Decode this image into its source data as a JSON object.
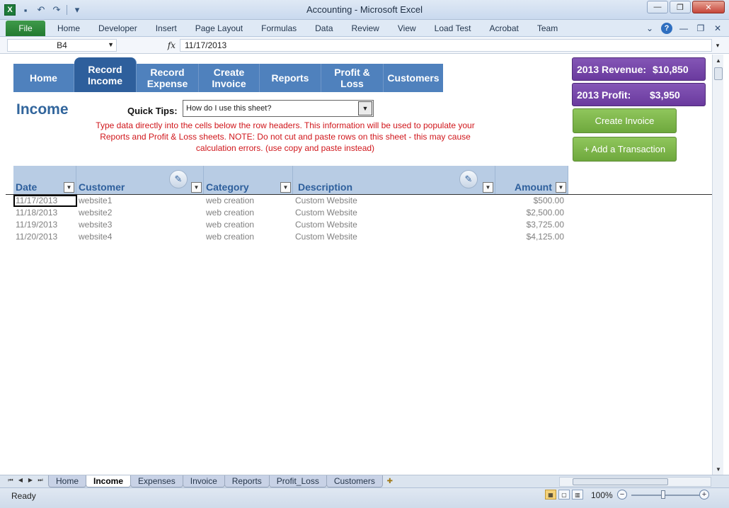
{
  "window": {
    "title": "Accounting  -  Microsoft Excel",
    "app_icon": "X"
  },
  "ribbon": {
    "file_tab": "File",
    "tabs": [
      "Home",
      "Developer",
      "Insert",
      "Page Layout",
      "Formulas",
      "Data",
      "Review",
      "View",
      "Load Test",
      "Acrobat",
      "Team"
    ]
  },
  "formula_bar": {
    "name_box": "B4",
    "fx_label": "fx",
    "value": "11/17/2013"
  },
  "nav": {
    "items": [
      {
        "label": "Home"
      },
      {
        "label": "Record Income",
        "active": true
      },
      {
        "label": "Record Expense"
      },
      {
        "label": "Create Invoice"
      },
      {
        "label": "Reports"
      },
      {
        "label": "Profit & Loss"
      },
      {
        "label": "Customers"
      }
    ]
  },
  "page": {
    "title": "Income",
    "quick_tips_label": "Quick Tips:",
    "quick_tips_selected": "How do I use this sheet?",
    "tips_text": "Type data directly into the cells below the row headers.  This information will be used to populate your Reports and Profit & Loss sheets.  NOTE: Do not cut and paste rows on this sheet - this may cause calculation errors. (use copy and paste instead)"
  },
  "summary": {
    "revenue_label": "2013 Revenue:",
    "revenue_value": "$10,850",
    "profit_label": "2013 Profit:",
    "profit_value": "$3,950"
  },
  "actions": {
    "create_invoice": "Create Invoice",
    "add_transaction": "+ Add a Transaction"
  },
  "table": {
    "headers": [
      "Date",
      "Customer",
      "Category",
      "Description",
      "Amount"
    ],
    "rows": [
      {
        "date": "11/17/2013",
        "customer": "website1",
        "category": "web creation",
        "description": "Custom Website",
        "amount": "$500.00"
      },
      {
        "date": "11/18/2013",
        "customer": "website2",
        "category": "web creation",
        "description": "Custom Website",
        "amount": "$2,500.00"
      },
      {
        "date": "11/19/2013",
        "customer": "website3",
        "category": "web creation",
        "description": "Custom Website",
        "amount": "$3,725.00"
      },
      {
        "date": "11/20/2013",
        "customer": "website4",
        "category": "web creation",
        "description": "Custom Website",
        "amount": "$4,125.00"
      }
    ]
  },
  "sheet_tabs": {
    "tabs": [
      "Home",
      "Income",
      "Expenses",
      "Invoice",
      "Reports",
      "Profit_Loss",
      "Customers"
    ],
    "active": "Income"
  },
  "status": {
    "ready": "Ready",
    "zoom": "100%"
  }
}
